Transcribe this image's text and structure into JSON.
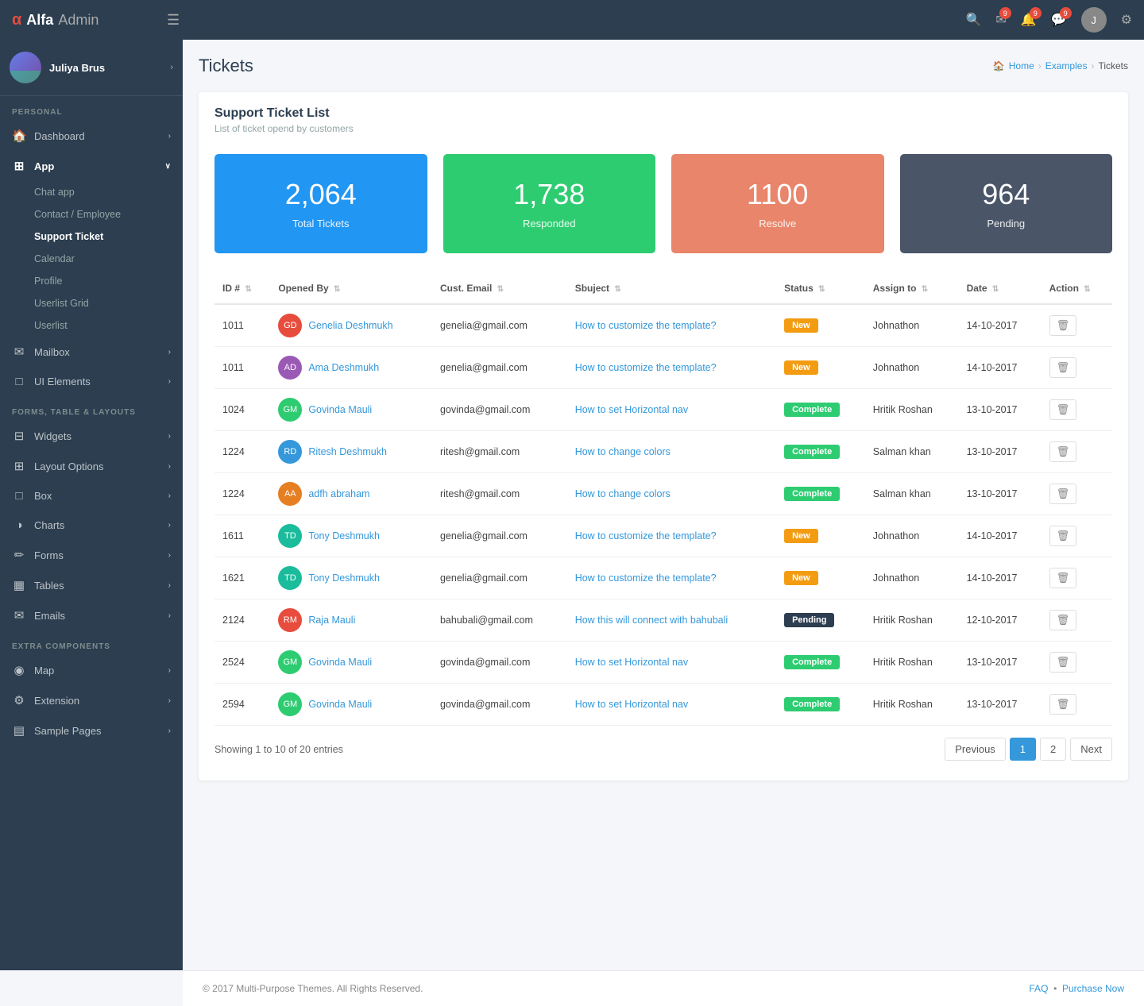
{
  "app": {
    "brand": {
      "alpha": "α",
      "alfa": "Alfa",
      "admin": "Admin"
    },
    "hamburger_icon": "☰",
    "settings_icon": "⚙"
  },
  "topbar": {
    "search_icon": "🔍",
    "email_icon": "✉",
    "email_badge": "9",
    "bell_icon": "🔔",
    "bell_badge": "9",
    "chat_icon": "💬",
    "chat_badge": "9",
    "settings_icon": "⚙"
  },
  "sidebar": {
    "user": {
      "name": "Juliya Brus"
    },
    "sections": [
      {
        "title": "PERSONAL",
        "items": [
          {
            "id": "dashboard",
            "label": "Dashboard",
            "icon": "🏠",
            "has_children": true
          },
          {
            "id": "app",
            "label": "App",
            "icon": "⊞",
            "has_children": true,
            "expanded": true,
            "children": [
              {
                "id": "chat-app",
                "label": "Chat app",
                "active": false
              },
              {
                "id": "contact-employee",
                "label": "Contact / Employee",
                "active": false
              },
              {
                "id": "support-ticket",
                "label": "Support Ticket",
                "active": true
              },
              {
                "id": "calendar",
                "label": "Calendar",
                "active": false
              },
              {
                "id": "profile",
                "label": "Profile",
                "active": false
              },
              {
                "id": "userlist-grid",
                "label": "Userlist Grid",
                "active": false
              },
              {
                "id": "userlist",
                "label": "Userlist",
                "active": false
              }
            ]
          },
          {
            "id": "mailbox",
            "label": "Mailbox",
            "icon": "✉",
            "has_children": true
          },
          {
            "id": "ui-elements",
            "label": "UI Elements",
            "icon": "□",
            "has_children": true
          }
        ]
      },
      {
        "title": "FORMS, TABLE & LAYOUTS",
        "items": [
          {
            "id": "widgets",
            "label": "Widgets",
            "icon": "⊟",
            "has_children": true
          },
          {
            "id": "layout-options",
            "label": "Layout Options",
            "icon": "⊞",
            "has_children": true
          },
          {
            "id": "box",
            "label": "Box",
            "icon": "□",
            "has_children": true
          },
          {
            "id": "charts",
            "label": "Charts",
            "icon": "◑",
            "has_children": true
          },
          {
            "id": "forms",
            "label": "Forms",
            "icon": "✏",
            "has_children": true
          },
          {
            "id": "tables",
            "label": "Tables",
            "icon": "▦",
            "has_children": true
          },
          {
            "id": "emails",
            "label": "Emails",
            "icon": "✉",
            "has_children": true
          }
        ]
      },
      {
        "title": "EXTRA COMPONENTS",
        "items": [
          {
            "id": "map",
            "label": "Map",
            "icon": "◉",
            "has_children": true
          },
          {
            "id": "extension",
            "label": "Extension",
            "icon": "⚙",
            "has_children": true
          },
          {
            "id": "sample-pages",
            "label": "Sample Pages",
            "icon": "▤",
            "has_children": true
          }
        ]
      }
    ]
  },
  "page": {
    "title": "Tickets",
    "breadcrumb": [
      "Home",
      "Examples",
      "Tickets"
    ]
  },
  "support_ticket": {
    "title": "Support Ticket List",
    "subtitle": "List of ticket opend by customers",
    "stats": [
      {
        "id": "total",
        "number": "2,064",
        "label": "Total Tickets",
        "color": "blue"
      },
      {
        "id": "responded",
        "number": "1,738",
        "label": "Responded",
        "color": "green"
      },
      {
        "id": "resolve",
        "number": "1100",
        "label": "Resolve",
        "color": "salmon"
      },
      {
        "id": "pending",
        "number": "964",
        "label": "Pending",
        "color": "dark"
      }
    ],
    "columns": [
      {
        "id": "id",
        "label": "ID #",
        "sortable": true
      },
      {
        "id": "opened_by",
        "label": "Opened By",
        "sortable": true
      },
      {
        "id": "cust_email",
        "label": "Cust. Email",
        "sortable": true
      },
      {
        "id": "subject",
        "label": "Sbuject",
        "sortable": true
      },
      {
        "id": "status",
        "label": "Status",
        "sortable": true
      },
      {
        "id": "assign_to",
        "label": "Assign to",
        "sortable": true
      },
      {
        "id": "date",
        "label": "Date",
        "sortable": true
      },
      {
        "id": "action",
        "label": "Action",
        "sortable": true
      }
    ],
    "rows": [
      {
        "id": "1011",
        "opened_by": "Genelia Deshmukh",
        "avatar_initials": "GD",
        "avatar_color": "#e74c3c",
        "email": "genelia@gmail.com",
        "subject": "How to customize the template?",
        "status": "New",
        "status_class": "new",
        "assign_to": "Johnathon",
        "date": "14-10-2017"
      },
      {
        "id": "1011",
        "opened_by": "Ama Deshmukh",
        "avatar_initials": "AD",
        "avatar_color": "#9b59b6",
        "email": "genelia@gmail.com",
        "subject": "How to customize the template?",
        "status": "New",
        "status_class": "new",
        "assign_to": "Johnathon",
        "date": "14-10-2017"
      },
      {
        "id": "1024",
        "opened_by": "Govinda Mauli",
        "avatar_initials": "GM",
        "avatar_color": "#2ecc71",
        "email": "govinda@gmail.com",
        "subject": "How to set Horizontal nav",
        "status": "Complete",
        "status_class": "complete",
        "assign_to": "Hritik Roshan",
        "date": "13-10-2017"
      },
      {
        "id": "1224",
        "opened_by": "Ritesh Deshmukh",
        "avatar_initials": "RD",
        "avatar_color": "#3498db",
        "email": "ritesh@gmail.com",
        "subject": "How to change colors",
        "status": "Complete",
        "status_class": "complete",
        "assign_to": "Salman khan",
        "date": "13-10-2017"
      },
      {
        "id": "1224",
        "opened_by": "adfh abraham",
        "avatar_initials": "AA",
        "avatar_color": "#e67e22",
        "email": "ritesh@gmail.com",
        "subject": "How to change colors",
        "status": "Complete",
        "status_class": "complete",
        "assign_to": "Salman khan",
        "date": "13-10-2017"
      },
      {
        "id": "1611",
        "opened_by": "Tony Deshmukh",
        "avatar_initials": "TD",
        "avatar_color": "#1abc9c",
        "email": "genelia@gmail.com",
        "subject": "How to customize the template?",
        "status": "New",
        "status_class": "new",
        "assign_to": "Johnathon",
        "date": "14-10-2017"
      },
      {
        "id": "1621",
        "opened_by": "Tony Deshmukh",
        "avatar_initials": "TD",
        "avatar_color": "#1abc9c",
        "email": "genelia@gmail.com",
        "subject": "How to customize the template?",
        "status": "New",
        "status_class": "new",
        "assign_to": "Johnathon",
        "date": "14-10-2017"
      },
      {
        "id": "2124",
        "opened_by": "Raja Mauli",
        "avatar_initials": "RM",
        "avatar_color": "#e74c3c",
        "email": "bahubali@gmail.com",
        "subject": "How this will connect with bahubali",
        "status": "Pending",
        "status_class": "pending",
        "assign_to": "Hritik Roshan",
        "date": "12-10-2017"
      },
      {
        "id": "2524",
        "opened_by": "Govinda Mauli",
        "avatar_initials": "GM",
        "avatar_color": "#2ecc71",
        "email": "govinda@gmail.com",
        "subject": "How to set Horizontal nav",
        "status": "Complete",
        "status_class": "complete",
        "assign_to": "Hritik Roshan",
        "date": "13-10-2017"
      },
      {
        "id": "2594",
        "opened_by": "Govinda Mauli",
        "avatar_initials": "GM",
        "avatar_color": "#2ecc71",
        "email": "govinda@gmail.com",
        "subject": "How to set Horizontal nav",
        "status": "Complete",
        "status_class": "complete",
        "assign_to": "Hritik Roshan",
        "date": "13-10-2017"
      }
    ],
    "pagination": {
      "info": "Showing 1 to 10 of 20 entries",
      "prev": "Previous",
      "next": "Next",
      "pages": [
        "1",
        "2"
      ],
      "current_page": "1"
    }
  },
  "footer": {
    "copyright": "© 2017 Multi-Purpose Themes. All Rights Reserved.",
    "faq_label": "FAQ",
    "purchase_label": "Purchase Now"
  }
}
